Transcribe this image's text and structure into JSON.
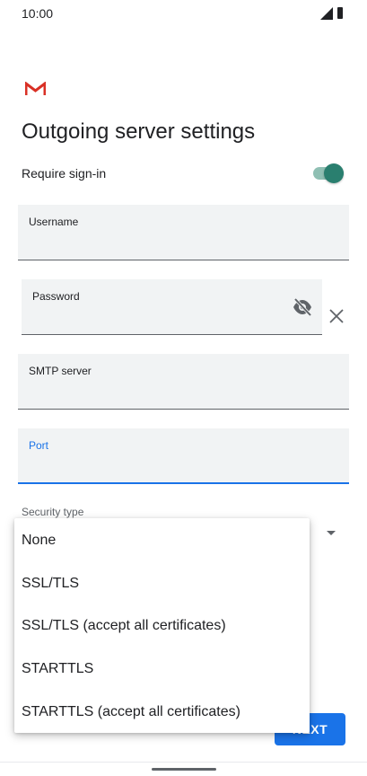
{
  "status_bar": {
    "time": "10:00",
    "icons": [
      "signal-icon",
      "battery-icon"
    ]
  },
  "app": {
    "logo": "gmail-logo",
    "title": "Outgoing server settings"
  },
  "require_signin": {
    "label": "Require sign-in",
    "enabled": true,
    "accent_color": "#2a7f6f"
  },
  "fields": {
    "username": {
      "label": "Username",
      "value": ""
    },
    "password": {
      "label": "Password",
      "value": "",
      "icon": "visibility-off-icon"
    },
    "smtp_server": {
      "label": "SMTP server",
      "value": ""
    },
    "port": {
      "label": "Port",
      "value": "",
      "focused": true
    }
  },
  "security_type": {
    "label": "Security type",
    "options": [
      "None",
      "SSL/TLS",
      "SSL/TLS (accept all certificates)",
      "STARTTLS",
      "STARTTLS (accept all certificates)"
    ]
  },
  "buttons": {
    "next_label": "NEXT",
    "next_color": "#1a73e8"
  }
}
